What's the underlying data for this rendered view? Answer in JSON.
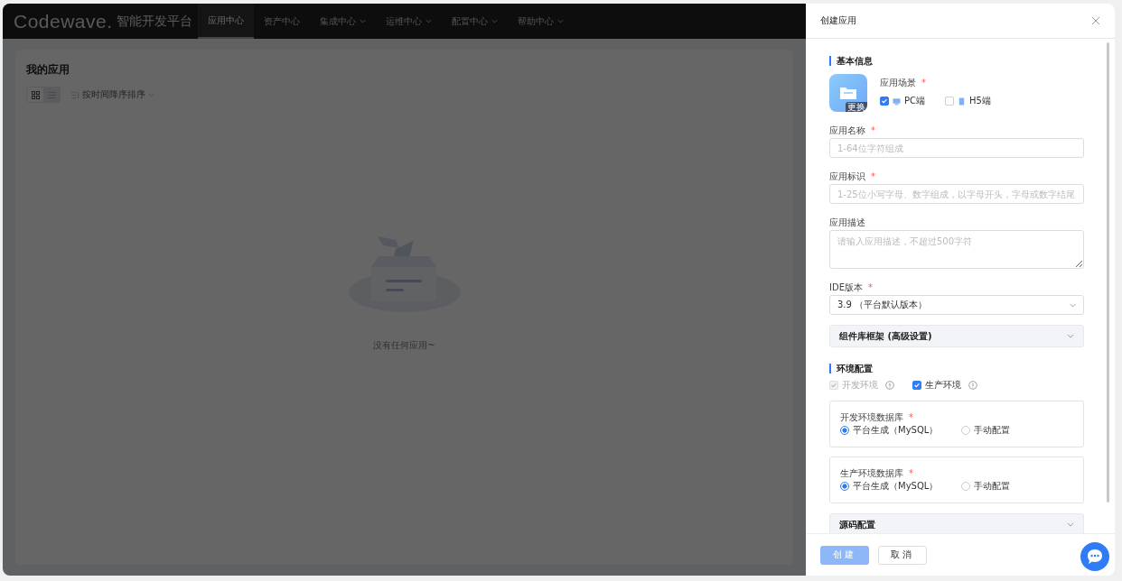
{
  "nav": {
    "logo": "Codewave.",
    "logo_suffix": "智能开发平台",
    "items": [
      {
        "label": "应用中心",
        "selected": true,
        "has_menu": false
      },
      {
        "label": "资产中心",
        "selected": false,
        "has_menu": false
      },
      {
        "label": "集成中心",
        "selected": false,
        "has_menu": true
      },
      {
        "label": "运维中心",
        "selected": false,
        "has_menu": true
      },
      {
        "label": "配置中心",
        "selected": false,
        "has_menu": true
      },
      {
        "label": "帮助中心",
        "selected": false,
        "has_menu": true
      }
    ]
  },
  "page": {
    "title": "我的应用",
    "view_modes": [
      {
        "kind": "grid",
        "selected": true
      },
      {
        "kind": "list",
        "selected": false
      }
    ],
    "sort": "按时间降序排序",
    "empty_text": "没有任何应用~"
  },
  "drawer": {
    "title": "创建应用",
    "basic": {
      "heading": "基本信息",
      "icon_caption": "更换",
      "scene": {
        "label": "应用场景",
        "required_mark": "*",
        "options": [
          {
            "label": "PC端",
            "kind": "pc",
            "checked": true
          },
          {
            "label": "H5端",
            "kind": "mobile",
            "checked": false
          }
        ]
      }
    },
    "fields": [
      {
        "label": "应用名称",
        "required_mark": "*",
        "kind": "input",
        "placeholder": "1-64位字符组成"
      },
      {
        "label": "应用标识",
        "required_mark": "*",
        "kind": "input",
        "placeholder": "1-25位小写字母、数字组成，以字母开头，字母或数字结尾"
      },
      {
        "label": "应用描述",
        "kind": "textarea",
        "placeholder": "请输入应用描述，不超过500字符"
      },
      {
        "label": "IDE版本",
        "required_mark": "*",
        "kind": "select",
        "value": "3.9 （平台默认版本）"
      }
    ],
    "advanced": {
      "label": "组件库框架 (高级设置)",
      "expanded": false
    },
    "env": {
      "heading": "环境配置",
      "options": [
        {
          "label": "开发环境",
          "checked": true,
          "disabled": true
        },
        {
          "label": "生产环境",
          "checked": true,
          "disabled": false
        }
      ],
      "databases": [
        {
          "label": "开发环境数据库",
          "required_mark": "*",
          "options": [
            {
              "label": "平台生成（MySQL）",
              "selected": true
            },
            {
              "label": "手动配置",
              "selected": false
            }
          ]
        },
        {
          "label": "生产环境数据库",
          "required_mark": "*",
          "options": [
            {
              "label": "平台生成（MySQL）",
              "selected": true
            },
            {
              "label": "手动配置",
              "selected": false
            }
          ]
        }
      ]
    },
    "source": {
      "label": "源码配置",
      "expanded": false
    },
    "buttons": [
      {
        "label": "创建",
        "kind": "primary",
        "disabled": true
      },
      {
        "label": "取消",
        "kind": "default",
        "disabled": false
      }
    ]
  }
}
